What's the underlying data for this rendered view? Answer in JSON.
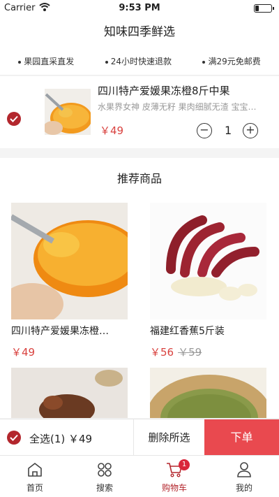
{
  "status_bar": {
    "carrier": "Carrier",
    "time": "9:53 PM"
  },
  "nav": {
    "title": "知味四季鲜选"
  },
  "features": [
    "果园直采直发",
    "24小时快速退款",
    "满29元免邮费"
  ],
  "cart": {
    "item": {
      "name": "四川特产爱媛果冻橙8斤中果",
      "desc": "水果界女神 皮薄无籽 果肉细腻无渣 宝宝…",
      "price": "￥49",
      "quantity": "1",
      "minus": "−",
      "plus": "+"
    }
  },
  "recommend": {
    "title": "推荐商品",
    "products": [
      {
        "name": "四川特产爱媛果冻橙…",
        "price": "￥49",
        "old_price": ""
      },
      {
        "name": "福建红香蕉5斤装",
        "price": "￥56",
        "old_price": "￥59"
      }
    ]
  },
  "bottom_bar": {
    "select_all": "全选(1) ￥49",
    "delete": "删除所选",
    "order": "下单"
  },
  "tab_bar": {
    "tabs": [
      {
        "label": "首页",
        "icon": "home-icon"
      },
      {
        "label": "搜索",
        "icon": "grid-icon"
      },
      {
        "label": "购物车",
        "icon": "cart-icon",
        "badge": "1"
      },
      {
        "label": "我的",
        "icon": "user-icon"
      }
    ]
  },
  "colors": {
    "accent": "#b3272d",
    "price": "#d9423f",
    "order_button": "#e9494f"
  }
}
